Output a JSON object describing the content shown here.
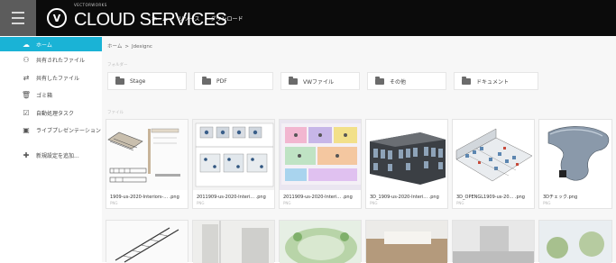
{
  "header": {
    "logo_letter": "V",
    "brand_small": "VECTORWORKS",
    "brand_big_bold": "CLOUD",
    "brand_big_light": " SERVICES",
    "nav": [
      "ホーム",
      "リソース",
      "ダウンロード"
    ]
  },
  "sidebar": {
    "items": [
      {
        "label": "ホーム",
        "icon": "cloud-icon",
        "glyph": "☁",
        "active": true
      },
      {
        "label": "共有されたファイル",
        "icon": "shared-users-icon",
        "glyph": "⚇",
        "active": false
      },
      {
        "label": "共有したファイル",
        "icon": "share-icon",
        "glyph": "⇄",
        "active": false
      },
      {
        "label": "ゴミ箱",
        "icon": "trash-icon",
        "glyph": "🗑",
        "active": false
      },
      {
        "label": "自動処理タスク",
        "icon": "tasks-icon",
        "glyph": "☑",
        "active": false
      },
      {
        "label": "ライブプレゼンテーション",
        "icon": "presentation-icon",
        "glyph": "▣",
        "active": false
      },
      {
        "label": "新規設定を追加...",
        "icon": "plus-icon",
        "glyph": "✚",
        "active": false
      }
    ]
  },
  "breadcrumb": {
    "root": "ホーム",
    "sep": ">",
    "current": "Jdesignc"
  },
  "labels": {
    "folders": "フォルダー",
    "files": "ファイル"
  },
  "folders": [
    {
      "name": "Stage"
    },
    {
      "name": "PDF"
    },
    {
      "name": "VWファイル"
    },
    {
      "name": "その他"
    },
    {
      "name": "ドキュメント"
    }
  ],
  "files": [
    {
      "name": "1909-us-2020-Interiors-... .png",
      "meta": "PNG",
      "thumb": "stair-plan"
    },
    {
      "name": "2011909-us-2020-Interi... .png",
      "meta": "PNG",
      "thumb": "office-plan"
    },
    {
      "name": "2011909-us-2020-Interi... .png",
      "meta": "PNG",
      "thumb": "color-plan"
    },
    {
      "name": "3D_1909-us-2020-Interi... .png",
      "meta": "PNG",
      "thumb": "dark-building"
    },
    {
      "name": "3D_OPENGL1909-us-20... .png",
      "meta": "PNG",
      "thumb": "iso-office"
    },
    {
      "name": "3Dチェック.png",
      "meta": "PNG",
      "thumb": "3d-shape"
    }
  ],
  "colors": {
    "accent": "#1ab3d6",
    "topbar": "#0b0b0b"
  }
}
